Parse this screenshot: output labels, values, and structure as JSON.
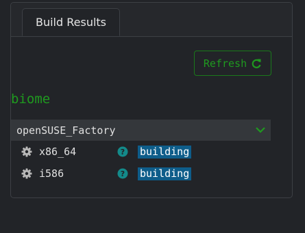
{
  "tabs": [
    {
      "label": "Build Results"
    }
  ],
  "toolbar": {
    "refresh_label": "Refresh",
    "refresh_icon": "refresh-icon"
  },
  "package": {
    "name": "biome"
  },
  "repository": {
    "name": "openSUSE_Factory",
    "expanded": true
  },
  "architectures": [
    {
      "name": "x86_64",
      "status": "building"
    },
    {
      "name": "i586",
      "status": "building"
    }
  ],
  "colors": {
    "accent_green": "#1f9a1f",
    "status_blue": "#0e5d8a",
    "help_teal": "#138a8a",
    "background": "#222428"
  }
}
